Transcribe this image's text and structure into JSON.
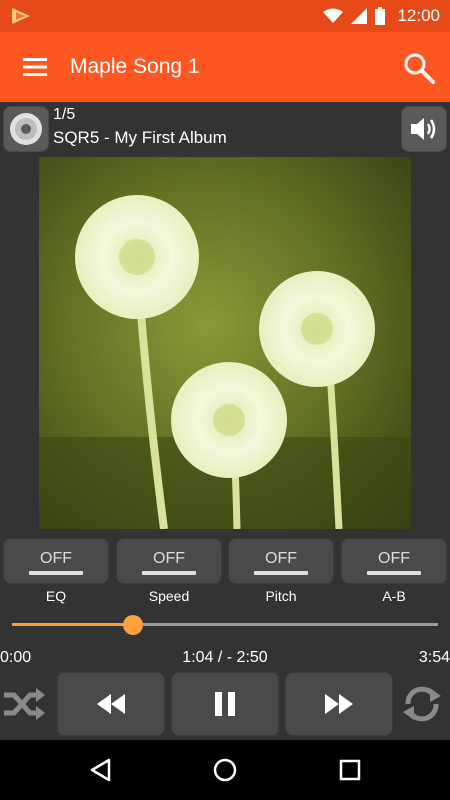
{
  "status_bar": {
    "time": "12:00",
    "icons": [
      "app-notification-icon",
      "wifi-icon",
      "signal-icon",
      "battery-icon"
    ]
  },
  "app_bar": {
    "title": "Maple Song 1",
    "icons": [
      "menu-icon",
      "search-icon"
    ]
  },
  "track_info": {
    "index": "1/5",
    "album_line": "SQR5 - My First Album",
    "icons": [
      "disc-icon",
      "volume-icon"
    ]
  },
  "album_art": {
    "subject": "dandelion-photo"
  },
  "toggles": [
    {
      "state": "OFF",
      "label": "EQ"
    },
    {
      "state": "OFF",
      "label": "Speed"
    },
    {
      "state": "OFF",
      "label": "Pitch"
    },
    {
      "state": "OFF",
      "label": "A-B"
    }
  ],
  "playback": {
    "start_time": "0:00",
    "current_time": "1:04 / - 2:50",
    "end_time": "3:54",
    "progress_fraction": 0.283
  },
  "controls": {
    "icons": [
      "shuffle-icon",
      "rewind-icon",
      "pause-icon",
      "fast-forward-icon",
      "repeat-icon"
    ]
  },
  "nav_bar": {
    "icons": [
      "back-icon",
      "home-icon",
      "recents-icon"
    ]
  },
  "colors": {
    "accent": "#ff5722",
    "status_bar": "#e64a19",
    "seek_fill": "#ff9a3c",
    "background": "#333333"
  }
}
